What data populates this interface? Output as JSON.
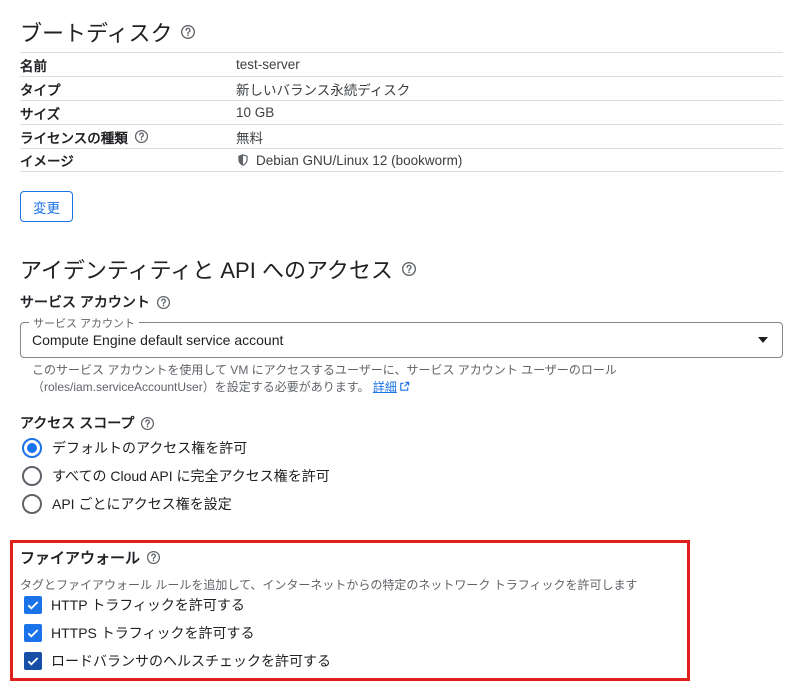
{
  "boot_disk": {
    "title": "ブートディスク",
    "rows": [
      {
        "key": "名前",
        "value": "test-server"
      },
      {
        "key": "タイプ",
        "value": "新しいバランス永続ディスク"
      },
      {
        "key": "サイズ",
        "value": "10 GB"
      },
      {
        "key": "ライセンスの種類",
        "value": "無料"
      },
      {
        "key": "イメージ",
        "value": "Debian GNU/Linux 12 (bookworm)"
      }
    ],
    "change_button": "変更"
  },
  "identity": {
    "title": "アイデンティティと API へのアクセス",
    "service_account_label": "サービス アカウント",
    "select_legend": "サービス アカウント",
    "select_value": "Compute Engine default service account",
    "hint_text": "このサービス アカウントを使用して VM にアクセスするユーザーに、サービス アカウント ユーザーのロール（roles/iam.serviceAccountUser）を設定する必要があります。",
    "hint_link": "詳細"
  },
  "access_scope": {
    "label": "アクセス スコープ",
    "options": [
      {
        "label": "デフォルトのアクセス権を許可",
        "checked": true
      },
      {
        "label": "すべての Cloud API に完全アクセス権を許可",
        "checked": false
      },
      {
        "label": "API ごとにアクセス権を設定",
        "checked": false
      }
    ]
  },
  "firewall": {
    "title": "ファイアウォール",
    "description": "タグとファイアウォール ルールを追加して、インターネットからの特定のネットワーク トラフィックを許可します",
    "options": [
      {
        "label": "HTTP トラフィックを許可する",
        "checked": true
      },
      {
        "label": "HTTPS トラフィックを許可する",
        "checked": true
      },
      {
        "label": "ロードバランサのヘルスチェックを許可する",
        "checked": true
      }
    ]
  },
  "colors": {
    "accent": "#1a73e8",
    "highlight": "#e0201b",
    "text": "#202124",
    "muted": "#5f6368"
  }
}
